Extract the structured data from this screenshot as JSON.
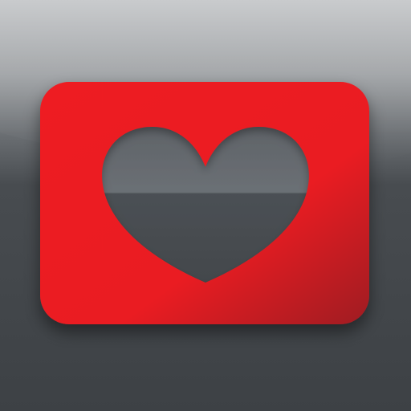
{
  "icon": {
    "name": "heart-card-icon",
    "description_visible": "",
    "colors": {
      "card_red": "#ec1c24",
      "card_red_dark": "#a81c22",
      "background_dark": "#3f4347",
      "background_light": "#b9bbbd",
      "heart_cutout_top": "#676c71",
      "heart_cutout_bottom": "#474c50"
    }
  }
}
